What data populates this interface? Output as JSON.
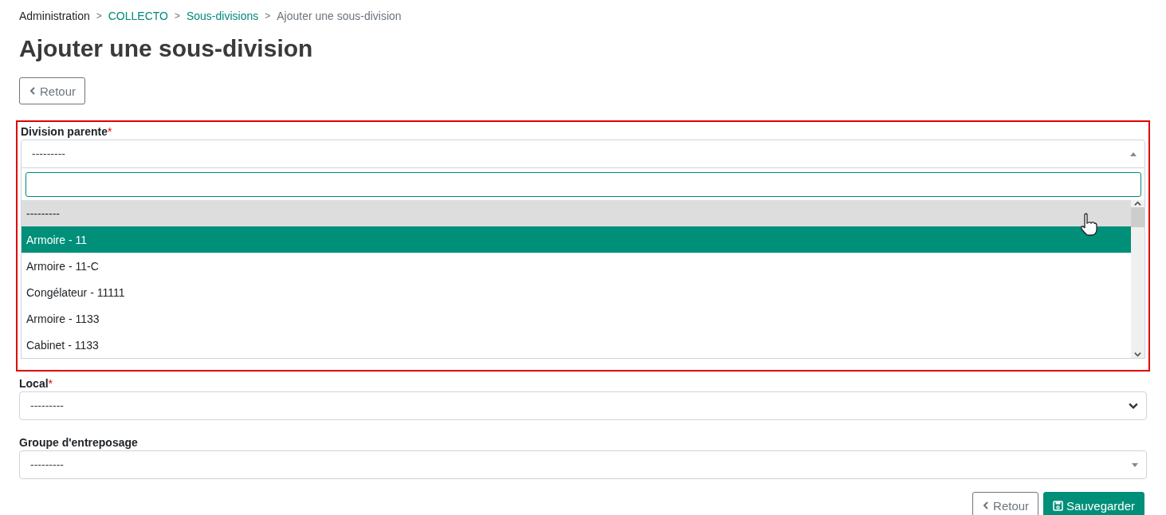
{
  "breadcrumb": [
    {
      "label": "Administration",
      "kind": "plain"
    },
    {
      "label": "COLLECTO",
      "kind": "link"
    },
    {
      "label": "Sous-divisions",
      "kind": "link"
    },
    {
      "label": "Ajouter une sous-division",
      "kind": "current"
    }
  ],
  "breadcrumb_separator": ">",
  "required_mark": "*",
  "title": "Ajouter une sous-division",
  "back_button": {
    "label": "Retour"
  },
  "fields": [
    {
      "label": "Division parente",
      "required": true,
      "value": "---------",
      "kind": "select2",
      "open": true,
      "highlighted": true,
      "dropdown": {
        "options": [
          {
            "label": "---------",
            "selected": true,
            "hovered": false
          },
          {
            "label": "Armoire - 11",
            "selected": false,
            "hovered": true
          },
          {
            "label": "Armoire - 11-C",
            "selected": false,
            "hovered": false
          },
          {
            "label": "Congélateur - 11111",
            "selected": false,
            "hovered": false
          },
          {
            "label": "Armoire - 1133",
            "selected": false,
            "hovered": false
          },
          {
            "label": "Cabinet - 1133",
            "selected": false,
            "hovered": false
          }
        ]
      }
    },
    {
      "label": "Local",
      "required": true,
      "value": "---------",
      "kind": "native",
      "open": false,
      "highlighted": false
    },
    {
      "label": "Groupe d'entreposage",
      "required": false,
      "value": "---------",
      "kind": "select2",
      "open": false,
      "highlighted": false
    }
  ],
  "footer_buttons": [
    {
      "label": "Retour",
      "kind": "back"
    },
    {
      "label": "Sauvegarder",
      "kind": "save"
    }
  ]
}
